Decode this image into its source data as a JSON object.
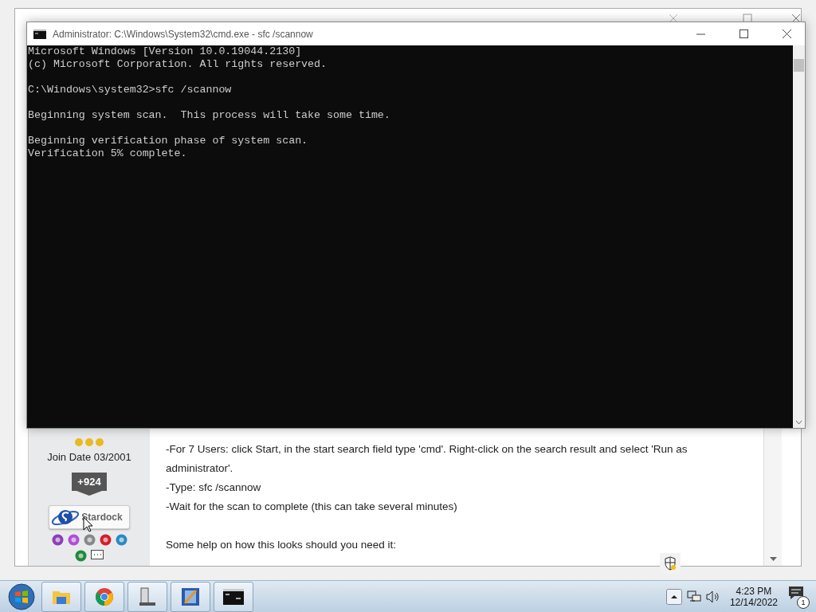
{
  "background_window": {
    "post": {
      "author": {
        "stars": 3,
        "join_date": "Join Date 03/2001",
        "karma": "+924",
        "badge": "Stardock"
      },
      "paragraphs": [
        "-For 7 Users: click Start, in the start search field type 'cmd'. Right-click on the search result and select 'Run as administrator'.",
        "-Type: sfc /scannow",
        "-Wait for the scan to complete (this can take several minutes)",
        "Some help on how this looks should you need it:"
      ]
    }
  },
  "console_window": {
    "title": "Administrator: C:\\Windows\\System32\\cmd.exe - sfc  /scannow",
    "blocks": [
      [
        "Microsoft Windows [Version 10.0.19044.2130]",
        "(c) Microsoft Corporation. All rights reserved."
      ],
      [
        "C:\\Windows\\system32>sfc /scannow"
      ],
      [
        "Beginning system scan.  This process will take some time."
      ],
      [
        "Beginning verification phase of system scan.",
        "Verification 5% complete."
      ]
    ]
  },
  "taskbar": {
    "apps": [
      {
        "kind": "folder"
      },
      {
        "kind": "browser"
      },
      {
        "kind": "document"
      },
      {
        "kind": "paint"
      },
      {
        "kind": "console"
      }
    ],
    "time": "4:23 PM",
    "date": "12/14/2022",
    "notifications": "1"
  }
}
